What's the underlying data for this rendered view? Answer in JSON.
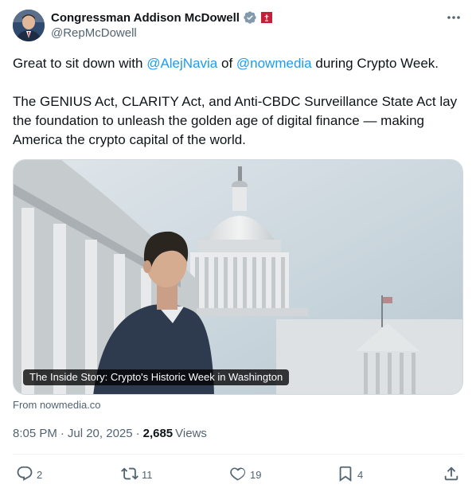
{
  "author": {
    "display_name": "Congressman Addison McDowell",
    "handle": "@RepMcDowell",
    "verified_icon": "verified-badge-icon",
    "affiliation_icon": "us-house-seal-icon"
  },
  "tweet": {
    "line1_prefix": "Great to sit down with ",
    "mention1": "@AlejNavia",
    "line1_mid": " of ",
    "mention2": "@nowmedia",
    "line1_suffix": " during Crypto Week.",
    "paragraph2": "The GENIUS Act, CLARITY Act, and Anti-CBDC Surveillance State Act lay the foundation to unleash the golden age of digital finance —  making America the crypto capital of the world."
  },
  "card": {
    "label": "The Inside Story: Crypto's Historic Week in Washington",
    "source": "From nowmedia.co"
  },
  "meta": {
    "time": "8:05 PM",
    "dot1": "·",
    "date": "Jul 20, 2025",
    "dot2": "·",
    "views_count": "2,685",
    "views_label": "Views"
  },
  "actions": {
    "replies": "2",
    "reposts": "11",
    "likes": "19",
    "bookmarks": "4"
  },
  "colors": {
    "link": "#1d9bf0",
    "secondary_text": "#536471",
    "primary_text": "#0f1419"
  }
}
